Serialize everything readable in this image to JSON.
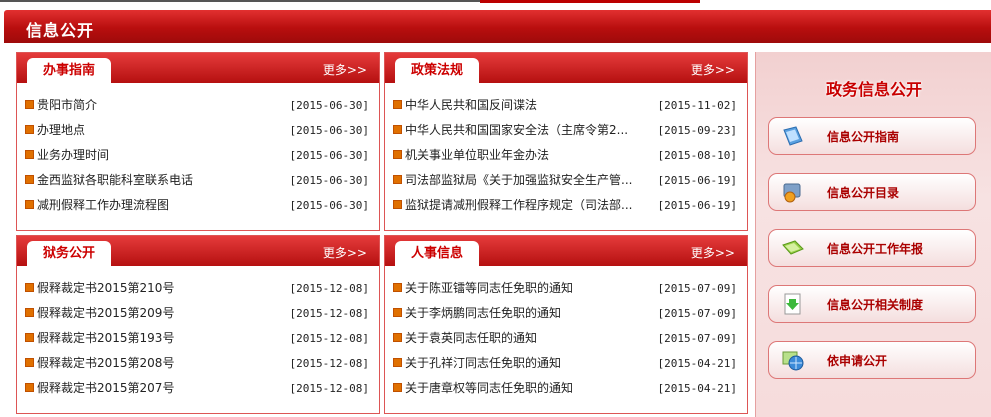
{
  "header": {
    "title": "信息公开"
  },
  "panels": {
    "guide": {
      "tab": "办事指南",
      "more": "更多>>",
      "items": [
        {
          "title": "贵阳市简介",
          "date": "[2015-06-30]"
        },
        {
          "title": "办理地点",
          "date": "[2015-06-30]"
        },
        {
          "title": "业务办理时间",
          "date": "[2015-06-30]"
        },
        {
          "title": "金西监狱各职能科室联系电话",
          "date": "[2015-06-30]"
        },
        {
          "title": "减刑假释工作办理流程图",
          "date": "[2015-06-30]"
        }
      ]
    },
    "policy": {
      "tab": "政策法规",
      "more": "更多>>",
      "items": [
        {
          "title": "中华人民共和国反间谍法",
          "date": "[2015-11-02]"
        },
        {
          "title": "中华人民共和国国家安全法（主席令第2...",
          "date": "[2015-09-23]"
        },
        {
          "title": "机关事业单位职业年金办法",
          "date": "[2015-08-10]"
        },
        {
          "title": "司法部监狱局《关于加强监狱安全生产管...",
          "date": "[2015-06-19]"
        },
        {
          "title": "监狱提请减刑假释工作程序规定（司法部...",
          "date": "[2015-06-19]"
        }
      ]
    },
    "prison": {
      "tab": "狱务公开",
      "more": "更多>>",
      "items": [
        {
          "title": "假释裁定书2015第210号",
          "date": "[2015-12-08]"
        },
        {
          "title": "假释裁定书2015第209号",
          "date": "[2015-12-08]"
        },
        {
          "title": "假释裁定书2015第193号",
          "date": "[2015-12-08]"
        },
        {
          "title": "假释裁定书2015第208号",
          "date": "[2015-12-08]"
        },
        {
          "title": "假释裁定书2015第207号",
          "date": "[2015-12-08]"
        }
      ]
    },
    "personnel": {
      "tab": "人事信息",
      "more": "更多>>",
      "items": [
        {
          "title": "关于陈亚镭等同志任免职的通知",
          "date": "[2015-07-09]"
        },
        {
          "title": "关于李炳鹏同志任免职的通知",
          "date": "[2015-07-09]"
        },
        {
          "title": "关于袁英同志任职的通知",
          "date": "[2015-07-09]"
        },
        {
          "title": "关于孔祥汀同志任免职的通知",
          "date": "[2015-04-21]"
        },
        {
          "title": "关于唐章权等同志任免职的通知",
          "date": "[2015-04-21]"
        }
      ]
    }
  },
  "sidebar": {
    "title": "政务信息公开",
    "buttons": [
      {
        "label": "信息公开指南",
        "icon": "book-icon"
      },
      {
        "label": "信息公开目录",
        "icon": "catalog-icon"
      },
      {
        "label": "信息公开工作年报",
        "icon": "annual-report-icon"
      },
      {
        "label": "信息公开相关制度",
        "icon": "download-document-icon"
      },
      {
        "label": "依申请公开",
        "icon": "apply-globe-icon"
      }
    ]
  }
}
